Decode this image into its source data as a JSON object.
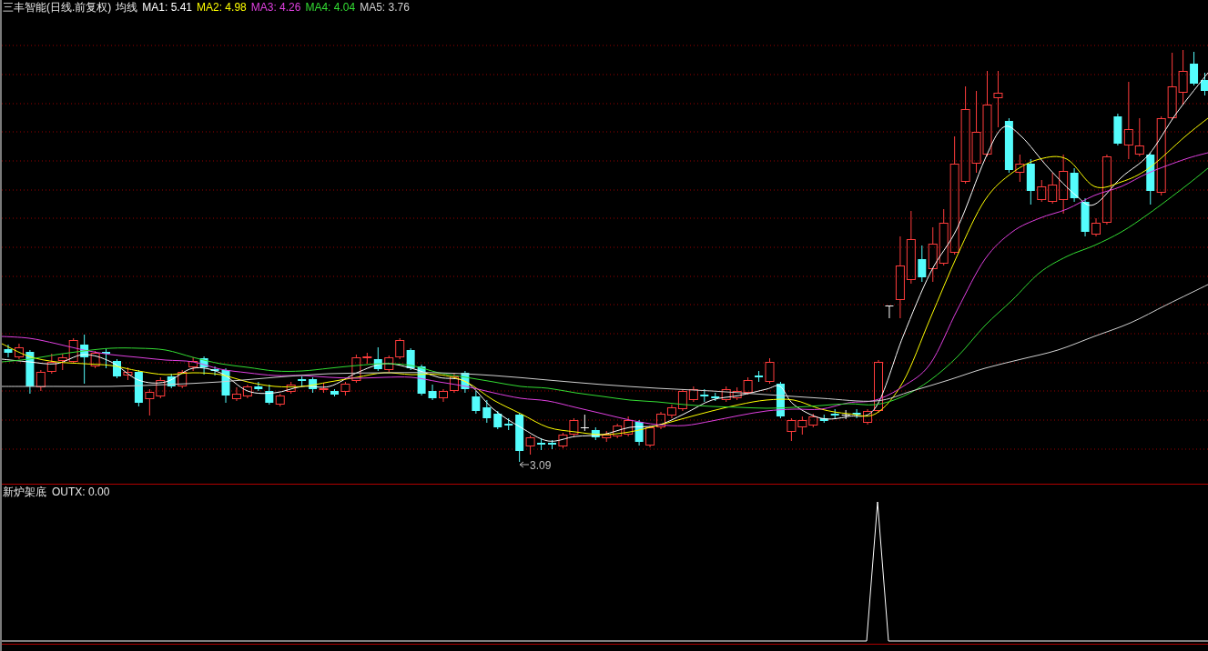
{
  "chart": {
    "title": "三丰智能(日线.前复权)",
    "indicator": "均线",
    "legend": [
      {
        "text": "MA1: 5.41",
        "color": "#ffffff"
      },
      {
        "text": "MA2: 4.98",
        "color": "#ffff00"
      },
      {
        "text": "MA3: 4.26",
        "color": "#e040e0"
      },
      {
        "text": "MA4: 4.04",
        "color": "#33dd33"
      },
      {
        "text": "MA5: 3.76",
        "color": "#d0d0d0"
      }
    ],
    "low_price_label": "3.09"
  },
  "indicator_panel": {
    "title": "新炉架底",
    "reading": "OUTX: 0.00"
  }
}
